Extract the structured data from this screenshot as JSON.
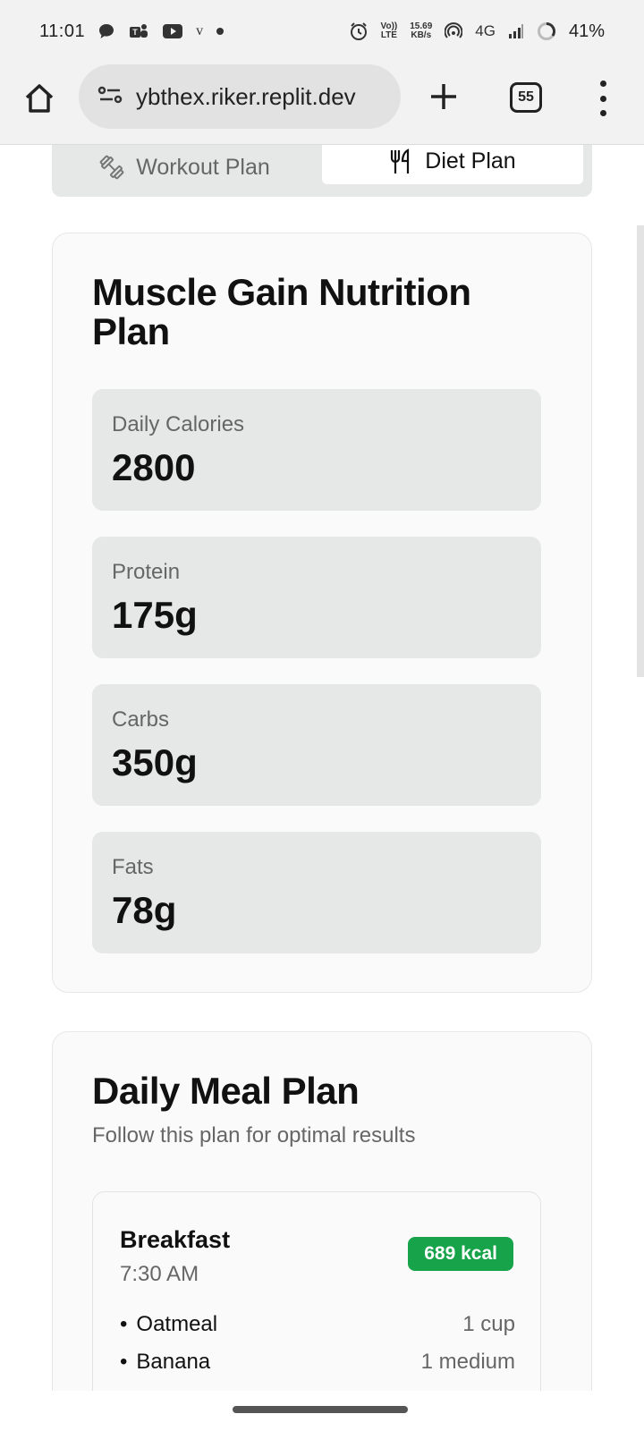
{
  "status_bar": {
    "time": "11:01",
    "letter_v": "v",
    "volte_top": "Vo))",
    "volte_bottom": "LTE",
    "speed_value": "15.69",
    "speed_unit": "KB/s",
    "network": "4G",
    "battery": "41%"
  },
  "browser": {
    "url": "ybthex.riker.replit.dev",
    "tab_count": "55"
  },
  "tabs": {
    "workout_label": "Workout Plan",
    "diet_label": "Diet Plan",
    "active": "Diet Plan"
  },
  "nutrition": {
    "title": "Muscle Gain Nutrition Plan",
    "stats": [
      {
        "label": "Daily Calories",
        "value": "2800"
      },
      {
        "label": "Protein",
        "value": "175g"
      },
      {
        "label": "Carbs",
        "value": "350g"
      },
      {
        "label": "Fats",
        "value": "78g"
      }
    ]
  },
  "meal_plan": {
    "title": "Daily Meal Plan",
    "subtitle": "Follow this plan for optimal results",
    "meals": [
      {
        "name": "Breakfast",
        "time": "7:30 AM",
        "kcal": "689 kcal",
        "foods": [
          {
            "name": "Oatmeal",
            "qty": "1 cup"
          },
          {
            "name": "Banana",
            "qty": "1 medium"
          }
        ]
      }
    ]
  },
  "colors": {
    "badge": "#16a34a",
    "stat_box": "#e6e7e7",
    "card": "#fafafa"
  }
}
